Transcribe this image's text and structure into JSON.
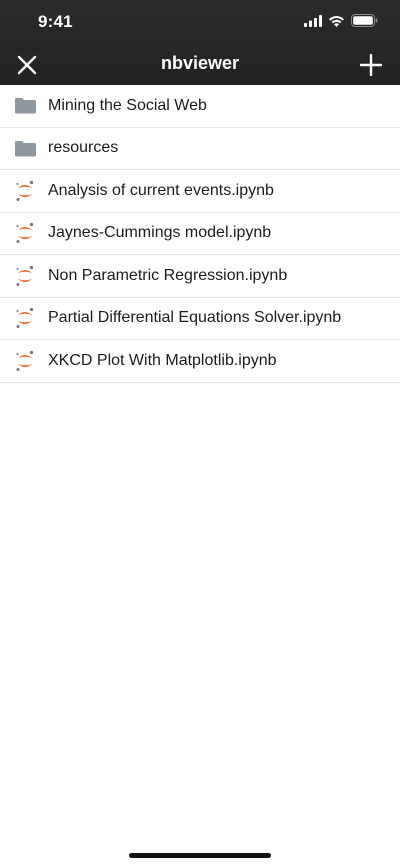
{
  "status_bar": {
    "time": "9:41"
  },
  "nav": {
    "title": "nbviewer",
    "close_icon": "close-icon",
    "add_icon": "plus-icon"
  },
  "files": {
    "items": [
      {
        "label": "Mining the Social Web",
        "kind": "folder"
      },
      {
        "label": "resources",
        "kind": "folder"
      },
      {
        "label": "Analysis of current events.ipynb",
        "kind": "notebook"
      },
      {
        "label": "Jaynes-Cummings model.ipynb",
        "kind": "notebook"
      },
      {
        "label": "Non Parametric Regression.ipynb",
        "kind": "notebook"
      },
      {
        "label": "Partial Differential Equations Solver.ipynb",
        "kind": "notebook"
      },
      {
        "label": "XKCD Plot With Matplotlib.ipynb",
        "kind": "notebook"
      }
    ]
  },
  "colors": {
    "header_bg": "#2b2b2d",
    "folder": "#8e979f",
    "jupyter_orange": "#e46e2e",
    "jupyter_gray": "#767677",
    "divider": "#e8e8ea"
  }
}
